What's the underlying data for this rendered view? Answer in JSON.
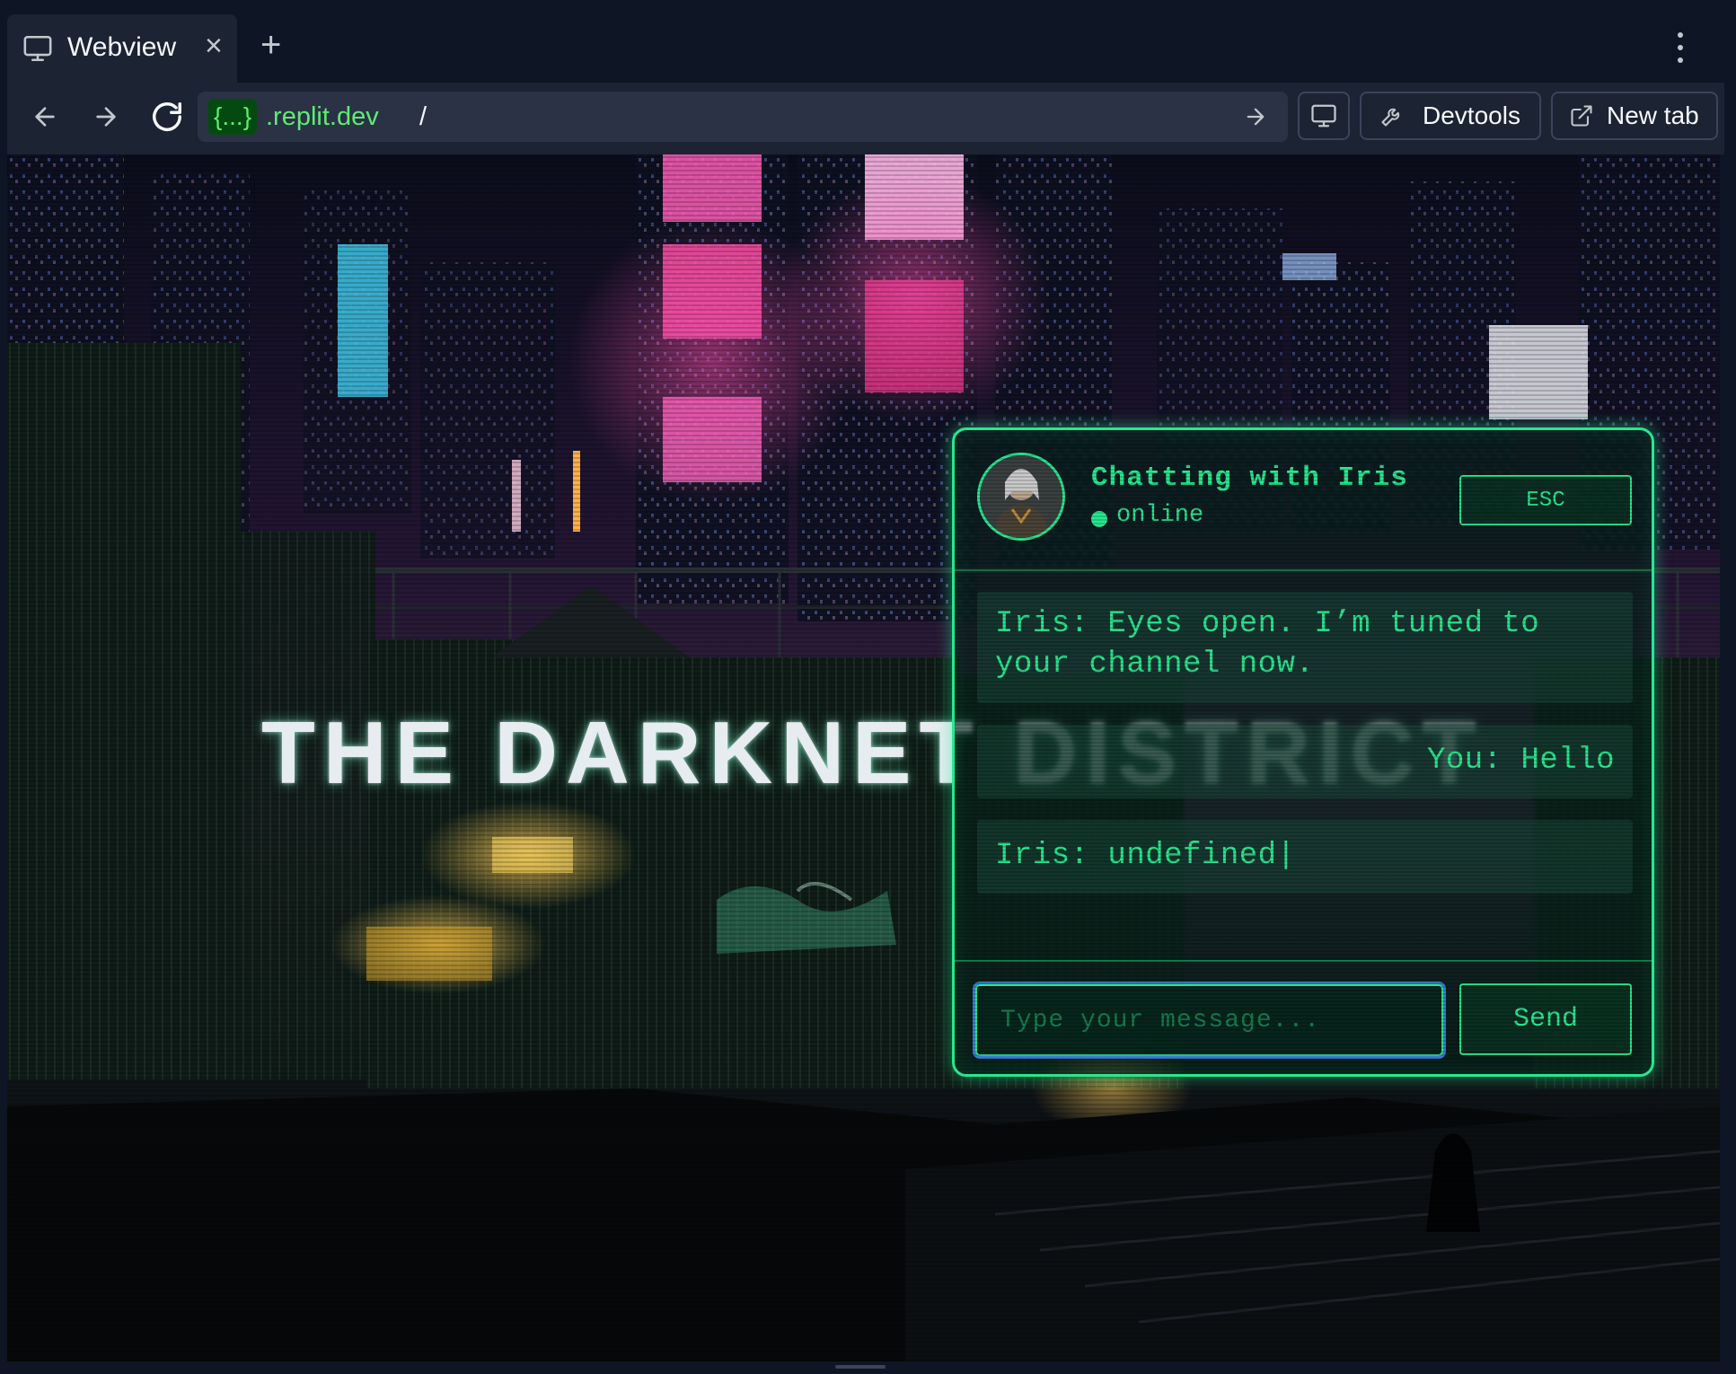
{
  "browser": {
    "tab": {
      "title": "Webview",
      "close_glyph": "×",
      "add_glyph": "+"
    },
    "icons": {
      "tab": "monitor-icon",
      "back": "arrow-left-icon",
      "forward": "arrow-right-icon",
      "reload": "reload-icon",
      "go": "arrow-right-icon",
      "screen": "monitor-icon",
      "devtools": "wrench-icon",
      "new_tab": "external-link-icon",
      "menu": "kebab-menu-icon"
    },
    "url": {
      "chip": "{...}",
      "domain": ".replit.dev",
      "path": "/"
    },
    "buttons": {
      "devtools": "Devtools",
      "new_tab": "New tab"
    }
  },
  "page": {
    "hero_title": "THE DARKNET DISTRICT",
    "chat": {
      "title": "Chatting with Iris",
      "status": "online",
      "esc_label": "ESC",
      "messages": [
        {
          "text": "Iris: Eyes open. I’m tuned to your channel now."
        },
        {
          "text": "You: Hello"
        },
        {
          "text": "Iris: undefined"
        }
      ],
      "input_placeholder": "Type your message...",
      "send_label": "Send"
    }
  },
  "colors": {
    "chrome_bg": "#1c2333",
    "tabbar_bg": "#0e1525",
    "url_green": "#5eeb74",
    "chat_accent": "#26e890",
    "input_focus": "#3a7bd5"
  }
}
